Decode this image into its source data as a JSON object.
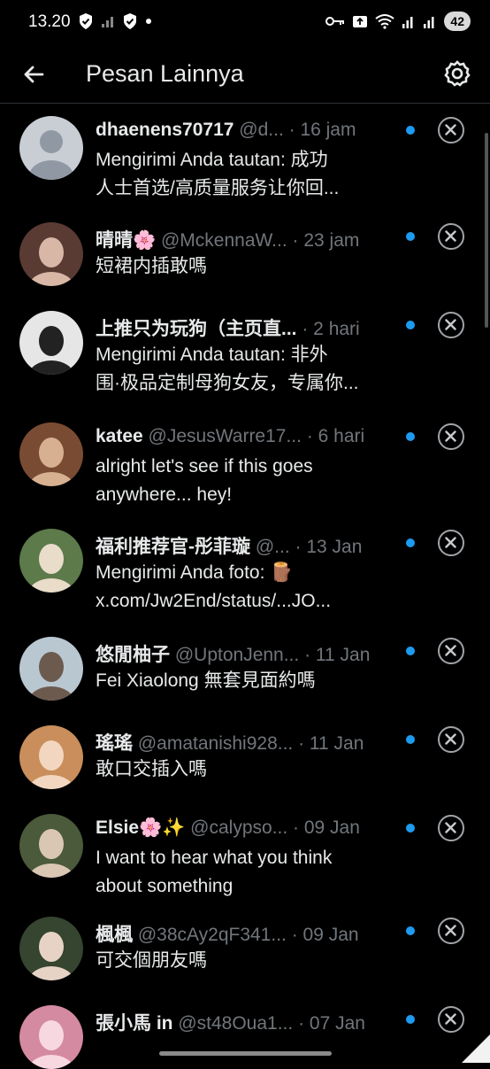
{
  "status": {
    "time": "13.20",
    "battery": "42"
  },
  "appbar": {
    "title": "Pesan Lainnya"
  },
  "conversations": [
    {
      "name": "dhaenens70717",
      "handle": "@d...",
      "time": "· 16 jam",
      "msg1": "Mengirimi Anda tautan: 成功",
      "msg2": "人士首选/高质量服务让你回..."
    },
    {
      "name": "晴晴🌸",
      "handle": "@MckennaW...",
      "time": "· 23 jam",
      "msg1": "短裙内插敢嗎",
      "msg2": ""
    },
    {
      "name": "上推只为玩狗（主页直...",
      "handle": "",
      "time": "· 2 hari",
      "msg1": "Mengirimi Anda tautan: 非外",
      "msg2": "围·极品定制母狗女友，专属你..."
    },
    {
      "name": "katee",
      "handle": "@JesusWarre17...",
      "time": "· 6 hari",
      "msg1": "alright let's see if this goes",
      "msg2": "anywhere... hey!"
    },
    {
      "name": "福利推荐官-彤菲璇",
      "handle": "@...",
      "time": "· 13 Jan",
      "msg1": "Mengirimi Anda foto: 🪵",
      "msg2": "x.com/Jw2End/status/...JO..."
    },
    {
      "name": "悠閒柚子",
      "handle": "@UptonJenn...",
      "time": "· 11 Jan",
      "msg1": "Fei Xiaolong 無套見面約嗎",
      "msg2": ""
    },
    {
      "name": "瑤瑤",
      "handle": "@amatanishi928...",
      "time": "· 11 Jan",
      "msg1": "敢口交插入嗎",
      "msg2": ""
    },
    {
      "name": "Elsie🌸✨",
      "handle": "@calypso...",
      "time": "· 09 Jan",
      "msg1": "I want to hear what you think",
      "msg2": "about something"
    },
    {
      "name": "楓楓",
      "handle": "@38cAy2qF341...",
      "time": "· 09 Jan",
      "msg1": "可交個朋友嗎",
      "msg2": ""
    },
    {
      "name": "張小馬 in",
      "handle": "@st48Oua1...",
      "time": "· 07 Jan",
      "msg1": "",
      "msg2": ""
    }
  ],
  "colors": {
    "accent": "#1d9bf0",
    "muted": "#71767b",
    "text": "#e7e9ea"
  }
}
